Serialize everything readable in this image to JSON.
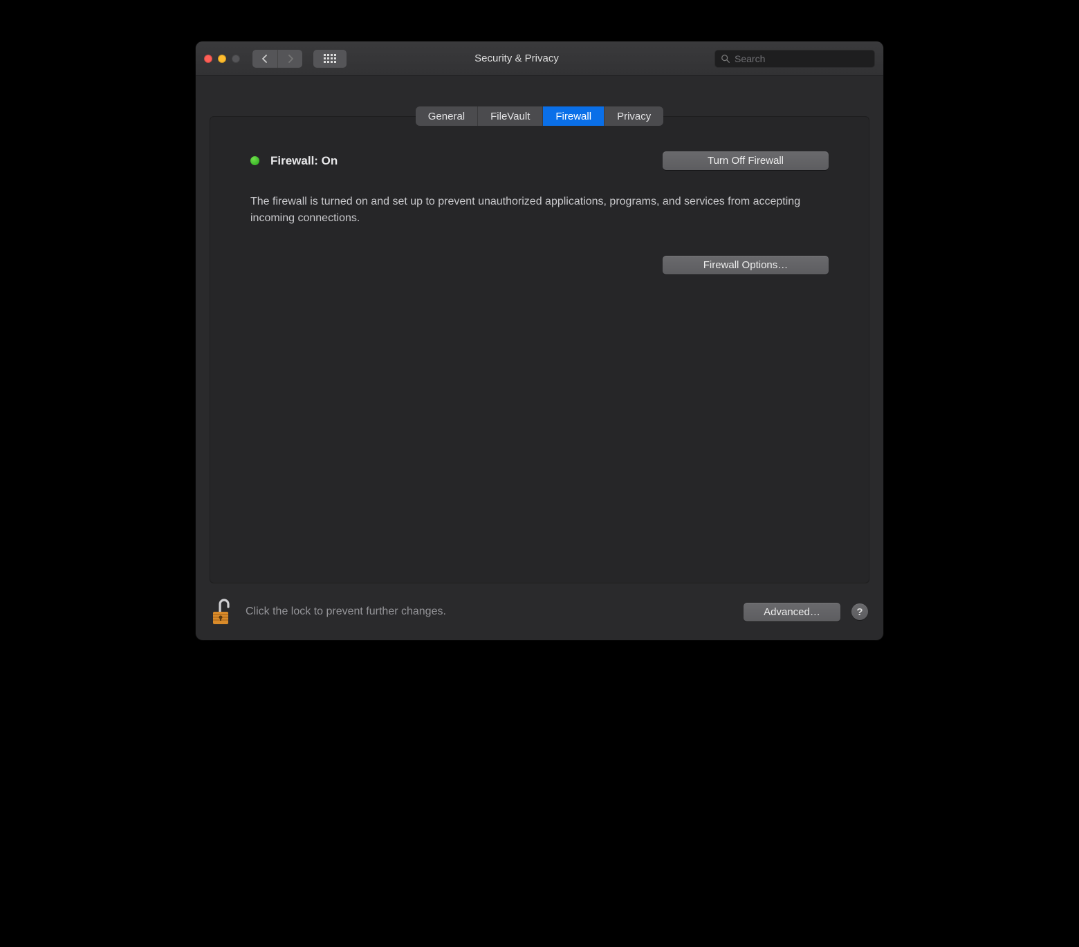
{
  "window": {
    "title": "Security & Privacy"
  },
  "search": {
    "placeholder": "Search"
  },
  "tabs": [
    {
      "label": "General",
      "active": false
    },
    {
      "label": "FileVault",
      "active": false
    },
    {
      "label": "Firewall",
      "active": true
    },
    {
      "label": "Privacy",
      "active": false
    }
  ],
  "main": {
    "status_label": "Firewall: On",
    "turn_off_label": "Turn Off Firewall",
    "description": "The firewall is turned on and set up to prevent unauthorized applications, programs, and services from accepting incoming connections.",
    "options_label": "Firewall Options…"
  },
  "footer": {
    "lock_text": "Click the lock to prevent further changes.",
    "advanced_label": "Advanced…",
    "help_label": "?"
  }
}
